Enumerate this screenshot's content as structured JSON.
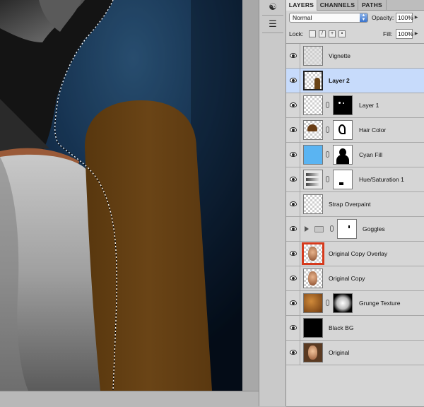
{
  "panel": {
    "tabs": [
      {
        "label": "LAYERS",
        "active": true
      },
      {
        "label": "CHANNELS",
        "active": false
      },
      {
        "label": "PATHS",
        "active": false
      }
    ],
    "blend_mode": "Normal",
    "opacity_label": "Opacity:",
    "opacity_value": "100%",
    "lock_label": "Lock:",
    "fill_label": "Fill:",
    "fill_value": "100%"
  },
  "layers": [
    {
      "name": "Vignette",
      "selected": false
    },
    {
      "name": "Layer 2",
      "selected": true
    },
    {
      "name": "Layer 1",
      "selected": false
    },
    {
      "name": "Hair Color",
      "selected": false
    },
    {
      "name": "Cyan Fill",
      "selected": false
    },
    {
      "name": "Hue/Saturation 1",
      "selected": false
    },
    {
      "name": "Strap Overpaint",
      "selected": false
    },
    {
      "name": "Goggles",
      "selected": false
    },
    {
      "name": "Original Copy Overlay",
      "selected": false
    },
    {
      "name": "Original Copy",
      "selected": false
    },
    {
      "name": "Grunge Texture",
      "selected": false
    },
    {
      "name": "Black BG",
      "selected": false
    },
    {
      "name": "Original",
      "selected": false
    }
  ],
  "colors": {
    "selection_highlight": "#c7dbfb",
    "brown_paint": "#5e3b11",
    "cyan_fill": "#5ab4f2",
    "active_thumb_border": "#d63a1c"
  }
}
